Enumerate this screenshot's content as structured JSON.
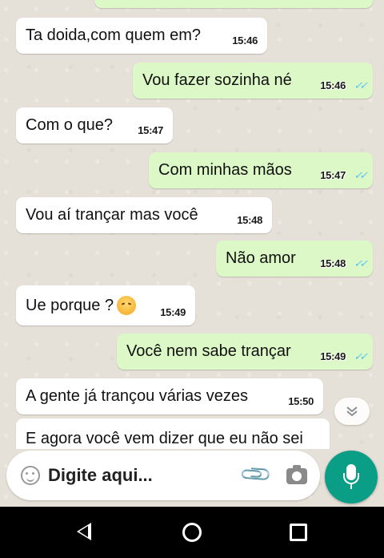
{
  "messages": [
    {
      "direction": "in",
      "text": "Ta doida,com quem em?",
      "time": "15:46"
    },
    {
      "direction": "out",
      "text": "Vou fazer sozinha né",
      "time": "15:46",
      "ticks": "✓✓"
    },
    {
      "direction": "in",
      "text": "Com o que?",
      "time": "15:47"
    },
    {
      "direction": "out",
      "text": "Com minhas mãos",
      "time": "15:47",
      "ticks": "✓✓"
    },
    {
      "direction": "in",
      "text": "Vou aí trançar mas você",
      "time": "15:48"
    },
    {
      "direction": "out",
      "text": "Não amor",
      "time": "15:48",
      "ticks": "✓✓"
    },
    {
      "direction": "in",
      "text": "Ue porque ?",
      "emoji": "disappointed-face",
      "time": "15:49"
    },
    {
      "direction": "out",
      "text": "Você nem sabe trançar",
      "time": "15:49",
      "ticks": "✓✓"
    },
    {
      "direction": "in",
      "text": "A gente já trançou várias vezes",
      "time": "15:50"
    },
    {
      "direction": "in",
      "text": "E agora você vem dizer que eu não sei",
      "time": ""
    }
  ],
  "composer": {
    "placeholder": "Digite aqui..."
  },
  "colors": {
    "incoming_bubble": "#ffffff",
    "outgoing_bubble": "#dcf8c6",
    "accent": "#0a9e87",
    "read_ticks": "#4fc3f7",
    "background": "#e6e1d8"
  },
  "icons": {
    "scroll_down": "chevron-double-down-icon",
    "emoji": "smiley-icon",
    "attach": "paperclip-icon",
    "camera": "camera-icon",
    "mic": "microphone-icon",
    "nav_back": "back-triangle-icon",
    "nav_home": "home-circle-icon",
    "nav_recent": "recent-apps-square-icon"
  }
}
